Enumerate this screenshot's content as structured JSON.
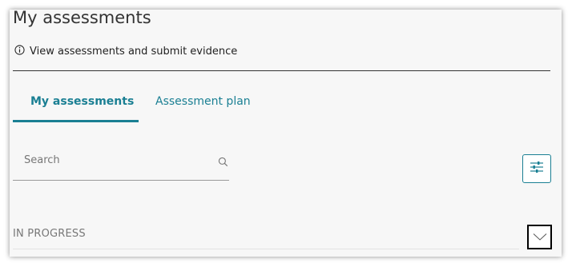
{
  "page": {
    "title": "My assessments",
    "info_text": "View assessments and submit evidence"
  },
  "tabs": [
    {
      "label": "My assessments",
      "active": true
    },
    {
      "label": "Assessment plan",
      "active": false
    }
  ],
  "search": {
    "placeholder": "Search",
    "value": ""
  },
  "filter": {
    "icon": "sliders-icon"
  },
  "section": {
    "label": "IN PROGRESS",
    "icon": "chevron-down-icon"
  },
  "colors": {
    "accent": "#1a7f93",
    "background": "#f7f7f7",
    "text": "#333333",
    "muted": "#777777"
  }
}
